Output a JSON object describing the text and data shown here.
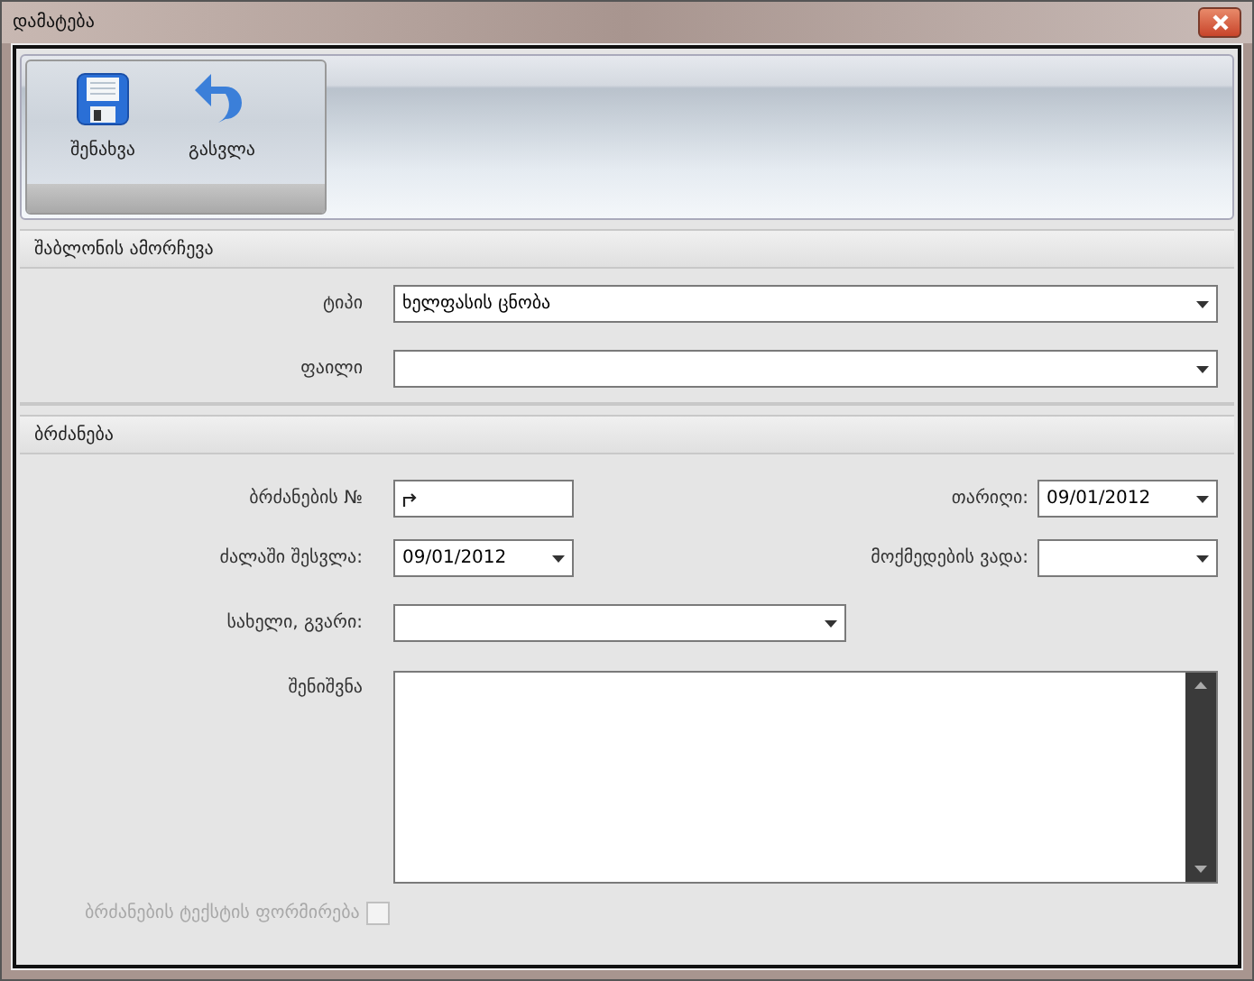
{
  "window": {
    "title": "დამატება"
  },
  "toolbar": [
    {
      "kind": "save",
      "label": "შენახვა"
    },
    {
      "kind": "exit",
      "label": "გასვლა"
    }
  ],
  "template_section": {
    "title": "შაბლონის ამორჩევა",
    "fields": [
      {
        "label": "ტიპი",
        "value": "ხელფასის ცნობა"
      },
      {
        "label": "ფაილი"
      }
    ]
  },
  "order_section": {
    "title": "ბრძანება",
    "order_number": {
      "label": "ბრძანების №"
    },
    "date": {
      "label": "თარიღი:",
      "value": "09/01/2012"
    },
    "effective_date": {
      "label": "ძალაში შესვლა:",
      "value": "09/01/2012"
    },
    "validity": {
      "label": "მოქმედების ვადა:"
    },
    "full_name": {
      "label": "სახელი, გვარი:"
    },
    "note": {
      "label": "შენიშვნა"
    },
    "generate_text": {
      "label": "ბრძანების ტექსტის ფორმირება",
      "checked": false,
      "disabled": true
    }
  }
}
